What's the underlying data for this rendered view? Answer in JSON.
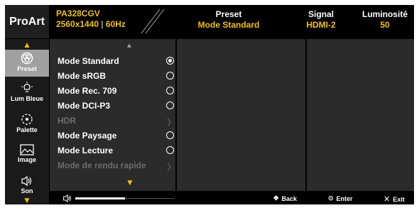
{
  "brand": "ProArt",
  "header": {
    "model": "PA328CGV",
    "resolution": "2560x1440",
    "refresh": "60Hz",
    "columns": [
      {
        "label": "Preset",
        "value": "Mode Standard"
      },
      {
        "label": "Signal",
        "value": "HDMI-2"
      },
      {
        "label": "Luminosité",
        "value": "50"
      }
    ]
  },
  "sidebar": {
    "items": [
      {
        "label": "Preset",
        "icon": "palette-circles-icon",
        "active": true
      },
      {
        "label": "Lum Bleue",
        "icon": "bulb-icon",
        "active": false
      },
      {
        "label": "Palette",
        "icon": "color-wheel-icon",
        "active": false
      },
      {
        "label": "Image",
        "icon": "image-icon",
        "active": false
      },
      {
        "label": "Son",
        "icon": "speaker-icon",
        "active": false
      }
    ]
  },
  "menu": {
    "items": [
      {
        "label": "Mode Standard",
        "control": "radio",
        "selected": true,
        "enabled": true
      },
      {
        "label": "Mode sRGB",
        "control": "radio",
        "selected": false,
        "enabled": true
      },
      {
        "label": "Mode Rec. 709",
        "control": "radio",
        "selected": false,
        "enabled": true
      },
      {
        "label": "Mode DCI-P3",
        "control": "radio",
        "selected": false,
        "enabled": true
      },
      {
        "label": "HDR",
        "control": "submenu",
        "selected": false,
        "enabled": false
      },
      {
        "label": "Mode Paysage",
        "control": "radio",
        "selected": false,
        "enabled": true
      },
      {
        "label": "Mode Lecture",
        "control": "radio",
        "selected": false,
        "enabled": true
      },
      {
        "label": "Mode de rendu rapide",
        "control": "submenu",
        "selected": false,
        "enabled": false
      }
    ]
  },
  "footer": {
    "volume_level": 0.5,
    "back": "Back",
    "enter": "Enter",
    "exit": "Exit"
  },
  "colors": {
    "accent": "#f2c200",
    "panel": "#2b2b2b",
    "active_tab": "#a0a0a0"
  }
}
